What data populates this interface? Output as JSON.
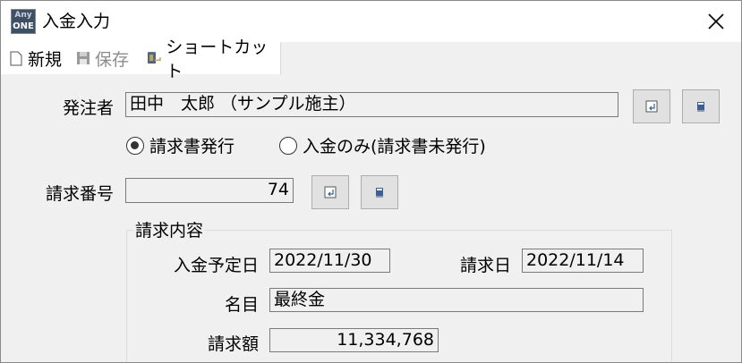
{
  "window": {
    "title": "入金入力",
    "icon_top": "Any",
    "icon_bottom": "ONE"
  },
  "toolbar": {
    "new_label": "新規",
    "save_label": "保存",
    "shortcut_label": "ショートカット"
  },
  "orderer": {
    "label": "発注者",
    "value": "田中　太郎 （サンプル施主）"
  },
  "radio": {
    "options": [
      {
        "label": "請求書発行",
        "selected": true
      },
      {
        "label": "入金のみ(請求書未発行)",
        "selected": false
      }
    ]
  },
  "invoice_number": {
    "label": "請求番号",
    "value": "74"
  },
  "details": {
    "group_title": "請求内容",
    "deposit_date_label": "入金予定日",
    "deposit_date_value": "2022/11/30",
    "invoice_date_label": "請求日",
    "invoice_date_value": "2022/11/14",
    "item_label": "名目",
    "item_value": "最終金",
    "amount_label": "請求額",
    "amount_value": "11,334,768"
  }
}
